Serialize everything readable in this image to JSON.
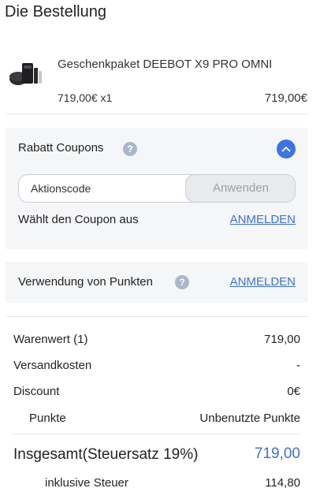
{
  "page": {
    "title": "Die Bestellung"
  },
  "product": {
    "name": "Geschenkpaket DEEBOT X9 PRO OMNI",
    "unit_price_qty": "719,00€ x1",
    "price": "719,00€",
    "image_icon": "robot-vacuum-product-icon"
  },
  "coupon": {
    "title": "Rabatt Coupons",
    "help_icon": "question-icon",
    "help_glyph": "?",
    "collapse_icon": "chevron-up-icon",
    "input_placeholder": "Aktionscode",
    "apply_label": "Anwenden",
    "select_label": "Wählt den Coupon aus",
    "login_label": "ANMELDEN"
  },
  "points": {
    "label": "Verwendung von Punkten",
    "help_icon": "question-icon",
    "help_glyph": "?",
    "login_label": "ANMELDEN"
  },
  "summary": {
    "rows": [
      {
        "label": "Warenwert (1)",
        "value": "719,00"
      },
      {
        "label": "Versandkosten",
        "value": "-"
      },
      {
        "label": "Discount",
        "value": "0€"
      },
      {
        "label": "Punkte",
        "value": "Unbenutzte Punkte"
      }
    ],
    "total_label": "Insgesamt(Steuersatz 19%)",
    "total_value": "719,00",
    "tax_label": "inklusive Steuer",
    "tax_value": "114,80"
  },
  "colors": {
    "accent": "#3d6fd8",
    "panel": "#f5f6f8",
    "button_blue": "#3d73e6"
  }
}
